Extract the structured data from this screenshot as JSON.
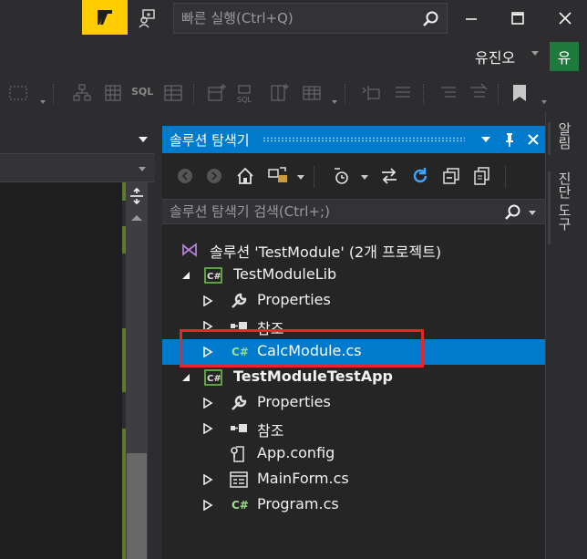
{
  "titlebar": {
    "quick_launch_placeholder": "빠른 실행(Ctrl+Q)",
    "icons": [
      "feedback-icon",
      "person-icon",
      "search-icon",
      "minimize-icon",
      "maximize-icon",
      "close-icon"
    ]
  },
  "account": {
    "name": "유진오",
    "avatar_initial": "유",
    "avatar_color": "#1e7a3c"
  },
  "toolbar": {
    "icons": [
      "layout-icon",
      "hierarchy-icon",
      "grid-icon",
      "sql-icon",
      "table-icon",
      "add-table-icon",
      "sql-query-icon",
      "add-column-icon",
      "relationship-icon",
      "index-icon",
      "comment-icon",
      "uncomment-icon",
      "bookmark-icon"
    ],
    "sql_label": "SQL"
  },
  "solution_explorer": {
    "title": "솔루션 탐색기",
    "search_placeholder": "솔루션 탐색기 검색(Ctrl+;)",
    "title_buttons": [
      "dropdown-icon",
      "pin-icon",
      "close-icon"
    ],
    "toolbar_icons": [
      "back-icon",
      "forward-icon",
      "home-icon",
      "sync-view-icon",
      "pending-changes-icon",
      "switch-views-icon",
      "refresh-icon",
      "collapse-all-icon",
      "copy-icon"
    ],
    "accent_color": "#007acc",
    "tree": [
      {
        "label": "솔루션 'TestModule' (2개 프로젝트)",
        "icon": "solution-icon",
        "expander": "none",
        "bold": false,
        "selected": false
      },
      {
        "label": "TestModuleLib",
        "icon": "csharp-project-icon",
        "expander": "expanded",
        "bold": false,
        "selected": false
      },
      {
        "label": "Properties",
        "icon": "wrench-icon",
        "expander": "collapsed",
        "bold": false,
        "selected": false
      },
      {
        "label": "참조",
        "icon": "references-icon",
        "expander": "collapsed",
        "bold": false,
        "selected": false
      },
      {
        "label": "CalcModule.cs",
        "icon": "csharp-file-icon",
        "expander": "collapsed",
        "bold": false,
        "selected": true
      },
      {
        "label": "TestModuleTestApp",
        "icon": "csharp-project-icon",
        "expander": "expanded",
        "bold": true,
        "selected": false
      },
      {
        "label": "Properties",
        "icon": "wrench-icon",
        "expander": "collapsed",
        "bold": false,
        "selected": false
      },
      {
        "label": "참조",
        "icon": "references-icon",
        "expander": "collapsed",
        "bold": false,
        "selected": false
      },
      {
        "label": "App.config",
        "icon": "config-icon",
        "expander": "none",
        "bold": false,
        "selected": false
      },
      {
        "label": "MainForm.cs",
        "icon": "form-icon",
        "expander": "collapsed",
        "bold": false,
        "selected": false
      },
      {
        "label": "Program.cs",
        "icon": "csharp-file-icon",
        "expander": "collapsed",
        "bold": false,
        "selected": false
      }
    ]
  },
  "side_tabs": [
    {
      "label": "알림"
    },
    {
      "label": "진단 도구"
    }
  ],
  "highlight_color": "#e8262a"
}
